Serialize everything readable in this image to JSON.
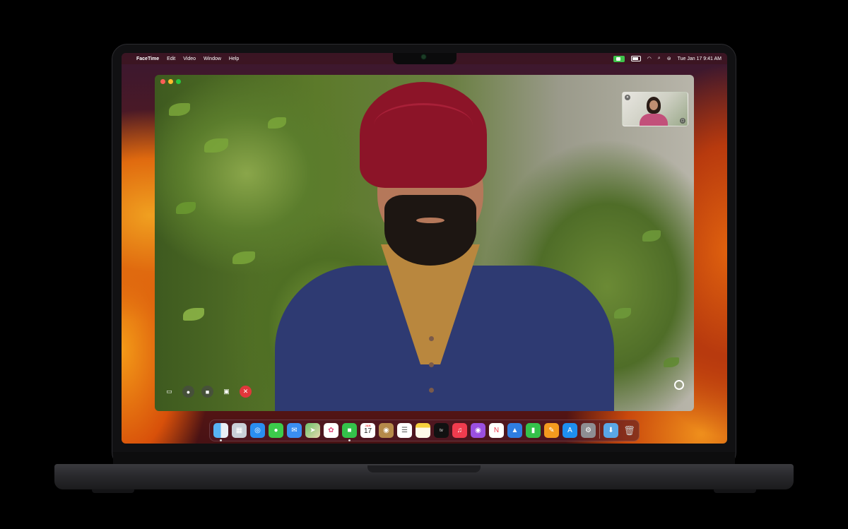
{
  "menubar": {
    "app_name": "FaceTime",
    "menus": [
      "Edit",
      "Video",
      "Window",
      "Help"
    ],
    "date_time": "Tue Jan 17  9:41 AM"
  },
  "call": {
    "controls": [
      "sidebar-icon",
      "microphone-icon",
      "video-camera-icon",
      "screen-share-icon",
      "end-call-icon"
    ]
  },
  "dock": {
    "calendar_month": "JAN",
    "calendar_day": "17",
    "tv_label": "tv",
    "apps": [
      "Finder",
      "Launchpad",
      "Safari",
      "Messages",
      "Mail",
      "Maps",
      "Photos",
      "FaceTime",
      "Calendar",
      "Contacts",
      "Reminders",
      "Notes",
      "TV",
      "Music",
      "Podcasts",
      "News",
      "Keynote",
      "Numbers",
      "Pages",
      "App Store",
      "System Settings",
      "Downloads",
      "Trash"
    ]
  },
  "colors": {
    "end_call": "#e2363b",
    "camera_indicator": "#3fc24a",
    "turban": "#8c1428",
    "cardigan": "#2e3a72"
  }
}
